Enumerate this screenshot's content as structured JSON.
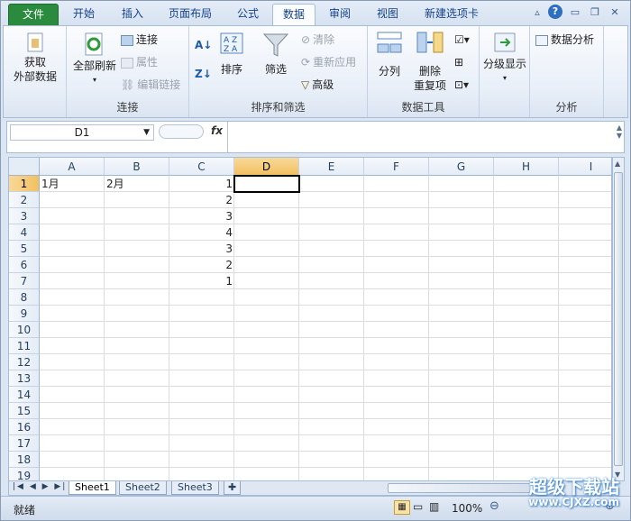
{
  "tabs": [
    {
      "label": "文件"
    },
    {
      "label": "开始"
    },
    {
      "label": "插入"
    },
    {
      "label": "页面布局"
    },
    {
      "label": "公式"
    },
    {
      "label": "数据"
    },
    {
      "label": "审阅"
    },
    {
      "label": "视图"
    },
    {
      "label": "新建选项卡"
    }
  ],
  "ribbon": {
    "get_external": {
      "line1": "获取",
      "line2": "外部数据"
    },
    "refresh_all": "全部刷新",
    "connections": "连接",
    "properties": "属性",
    "edit_links": "编辑链接",
    "group_connections": "连接",
    "sort": "排序",
    "filter": "筛选",
    "clear": "清除",
    "reapply": "重新应用",
    "advanced": "高级",
    "group_sort_filter": "排序和筛选",
    "text_to_columns": "分列",
    "remove_dup_line1": "删除",
    "remove_dup_line2": "重复项",
    "group_data_tools": "数据工具",
    "outline": "分级显示",
    "data_analysis": "数据分析",
    "group_analysis": "分析"
  },
  "formula_bar": {
    "name_box": "D1",
    "fx": "fx",
    "content": ""
  },
  "columns": [
    "A",
    "B",
    "C",
    "D",
    "E",
    "F",
    "G",
    "H",
    "I"
  ],
  "selected_column": "D",
  "rows": [
    "1",
    "2",
    "3",
    "4",
    "5",
    "6",
    "7",
    "8",
    "9",
    "10",
    "11",
    "12",
    "13",
    "14",
    "15",
    "16",
    "17",
    "18",
    "19"
  ],
  "cells": {
    "A1": "1月",
    "B1": "2月",
    "C1": "1",
    "C2": "2",
    "C3": "3",
    "C4": "4",
    "C5": "3",
    "C6": "2",
    "C7": "1"
  },
  "sheets": [
    {
      "label": "Sheet1"
    },
    {
      "label": "Sheet2"
    },
    {
      "label": "Sheet3"
    }
  ],
  "status": {
    "ready": "就绪",
    "zoom": "100%"
  },
  "watermark": {
    "line1": "超级下载站",
    "line2": "www.CJXZ.com"
  }
}
